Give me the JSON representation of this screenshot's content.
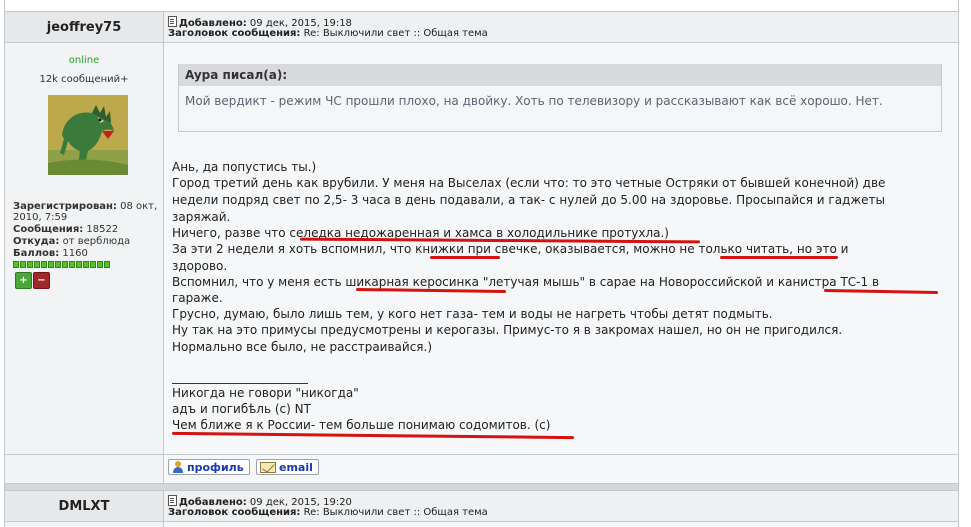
{
  "post1": {
    "username": "jeoffrey75",
    "added_label": "Добавлено:",
    "added_date": "09 дек, 2015, 19:18",
    "subject_label": "Заголовок сообщения:",
    "subject_value": "Re: Выключили свет :: Общая тема",
    "status": "online",
    "msg_count": "12k сообщений+",
    "profile": {
      "registered_label": "Зарегистрирован:",
      "registered_value_1": "08 окт,",
      "registered_value_2": "2010, 7:59",
      "messages_label": "Сообщения:",
      "messages_value": "18522",
      "from_label": "Откуда:",
      "from_value": "от верблюда",
      "points_label": "Баллов:",
      "points_value": "1160"
    },
    "quote": {
      "author": "Aypa писал(а):",
      "text": "Мой вердикт - режим ЧС прошли плохо, на двойку. Хоть по телевизору и рассказывают как всё хорошо. Нет."
    },
    "body_lines": [
      "Ань, да попустись ты.)",
      "Город третий день как врубили. У меня на Выселах (если что: то это четные Остряки от бывшей конечной) две",
      "недели подряд свет по 2,5- 3 часа в день подавали, а так- с нулей до 5.00 на здоровье. Просыпайся и гаджеты",
      "заряжай.",
      "Ничего, разве что селедка недожаренная и хамса в холодильнике протухла.)",
      "За эти 2 недели я хоть вспомнил, что книжки при свечке, оказывается, можно не только читать, но это и",
      "здорово.",
      "Вспомнил, что у меня есть шикарная керосинка \"летучая мышь\" в сарае на Новороссийской и канистра ТС-1 в",
      "гараже.",
      "Грусно, думаю, было лишь тем, у кого нет газа- тем и воды не нагреть чтобы детят подмыть.",
      "Ну так на это примусы предусмотрены и керогазы. Примус-то я в закромах нашел, но он не пригодился.",
      "Нормально все было, не расстраивайся.)"
    ],
    "signature_lines": [
      "Никогда не говори \"никогда\"",
      "адъ и погибѣль (с) NT",
      "Чем ближе я к России- тем больше понимаю содомитов. (с)"
    ],
    "buttons": {
      "profile": "профиль",
      "email": "email"
    }
  },
  "post2": {
    "username": "DMLXT",
    "added_label": "Добавлено:",
    "added_date": "09 дек, 2015, 19:20",
    "subject_label": "Заголовок сообщения:",
    "subject_value": "Re: Выключили свет :: Общая тема"
  },
  "colors": {
    "underline": "#d41212",
    "online": "#2aa02a",
    "link": "#1a3aa6"
  }
}
